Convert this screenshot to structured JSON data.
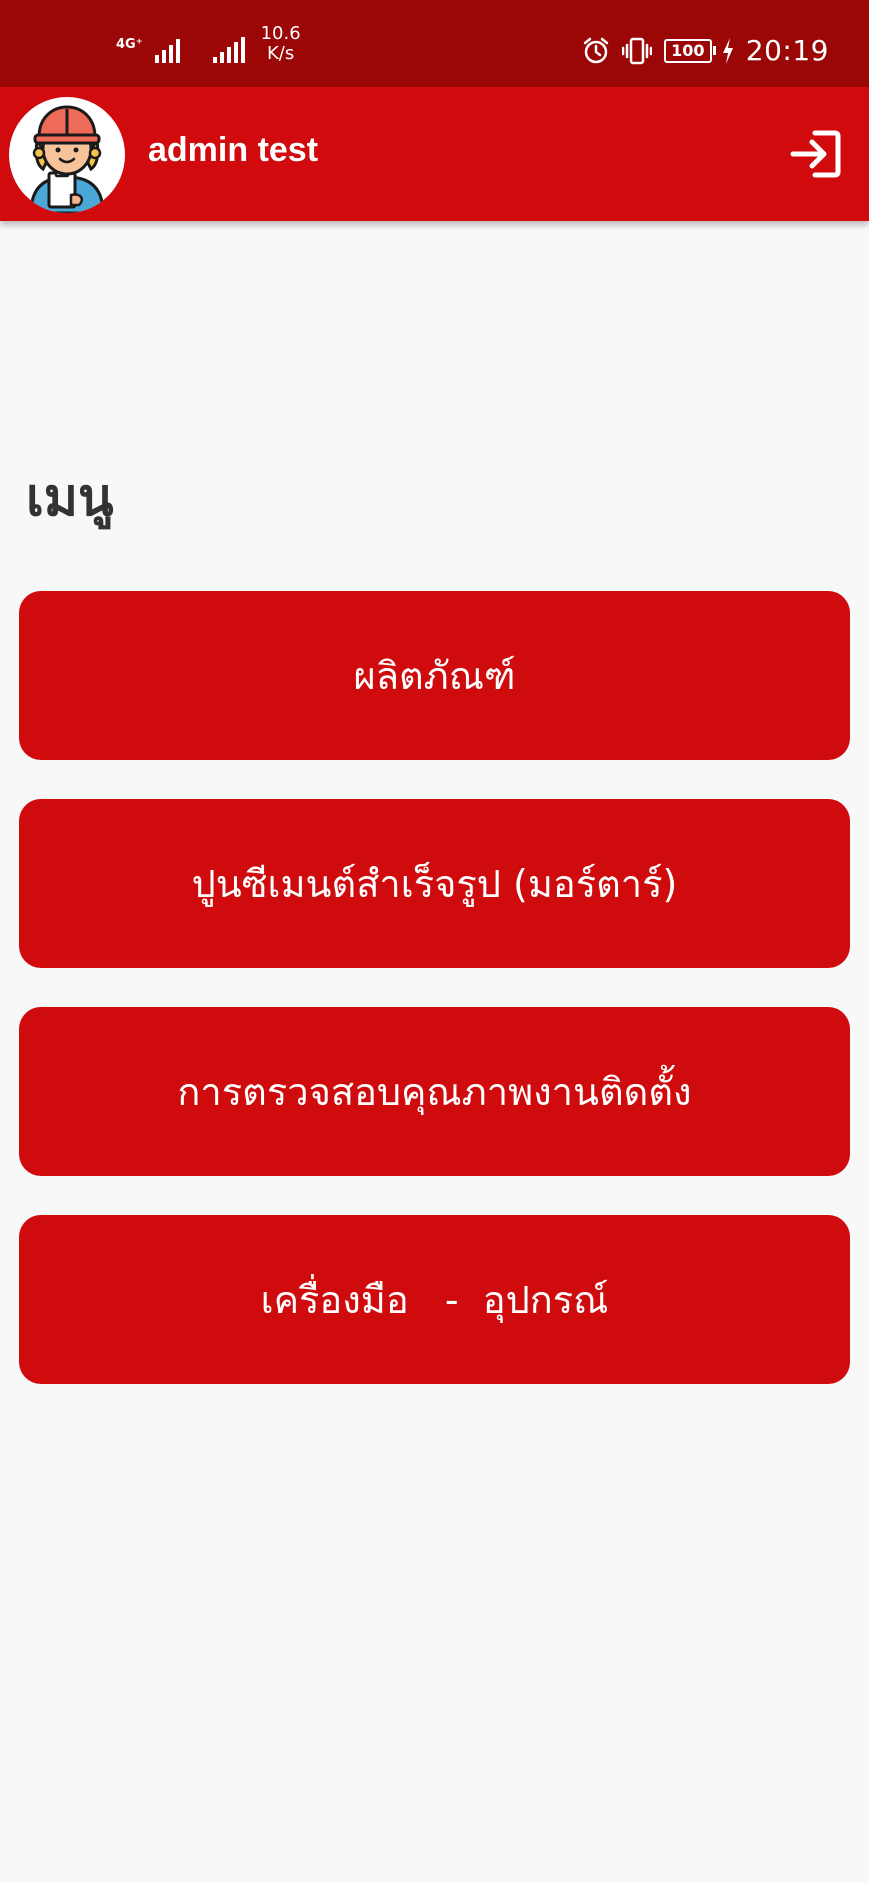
{
  "status_bar": {
    "network_type": "4G⁺",
    "net_speed_value": "10.6",
    "net_speed_unit": "K/s",
    "battery_level": "100",
    "time": "20:19"
  },
  "header": {
    "title": "admin test",
    "avatar_icon": "worker-avatar-icon",
    "logout_icon": "logout-icon"
  },
  "menu": {
    "heading": "เมนู",
    "items": [
      {
        "label": "ผลิตภัณฑ์"
      },
      {
        "label": "ปูนซีเมนต์สำเร็จรูป (มอร์ตาร์)"
      },
      {
        "label": "การตรวจสอบคุณภาพงานติดตั้ง"
      },
      {
        "label": "เครื่องมือ   -  อุปกรณ์"
      }
    ]
  },
  "colors": {
    "status_bar": "#9b0606",
    "app_bar": "#d00a0d",
    "button": "#cf0b0e",
    "background": "#f8f8f8"
  }
}
